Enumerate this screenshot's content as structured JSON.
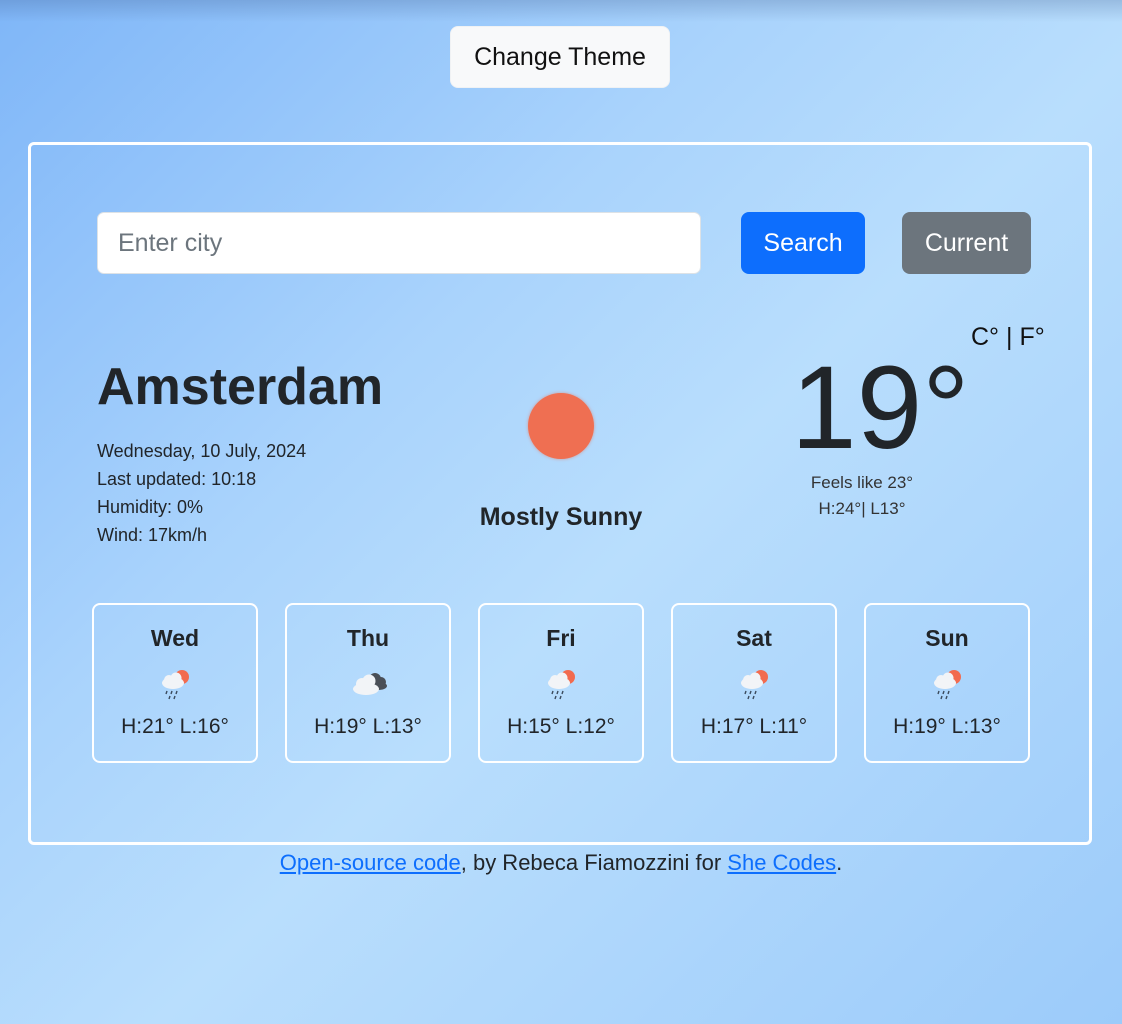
{
  "theme_button": "Change Theme",
  "search": {
    "placeholder": "Enter city",
    "value": "",
    "search_label": "Search",
    "current_label": "Current"
  },
  "current": {
    "city": "Amsterdam",
    "date": "Wednesday, 10 July, 2024",
    "last_updated": "Last updated: 10:18",
    "humidity": "Humidity: 0%",
    "wind": "Wind: 17km/h",
    "condition": "Mostly Sunny",
    "temperature": "19°",
    "unit_c": "C°",
    "unit_sep": "|",
    "unit_f": "F°",
    "feels_like": "Feels like 23°",
    "high_low": "H:24°| L13°",
    "icon": "sun-icon",
    "icon_color": "#ef6f52"
  },
  "forecast": [
    {
      "day": "Wed",
      "icon": "rain-sun-icon",
      "temps": "H:21° L:16°"
    },
    {
      "day": "Thu",
      "icon": "cloudy-icon",
      "temps": "H:19° L:13°"
    },
    {
      "day": "Fri",
      "icon": "rain-sun-icon",
      "temps": "H:15° L:12°"
    },
    {
      "day": "Sat",
      "icon": "rain-sun-icon",
      "temps": "H:17° L:11°"
    },
    {
      "day": "Sun",
      "icon": "rain-sun-icon",
      "temps": "H:19° L:13°"
    }
  ],
  "footer": {
    "link1": "Open-source code",
    "middle": ", by Rebeca Fiamozzini for ",
    "link2": "She Codes",
    "end": "."
  },
  "colors": {
    "primary": "#0d6efd",
    "secondary": "#6c757d"
  }
}
